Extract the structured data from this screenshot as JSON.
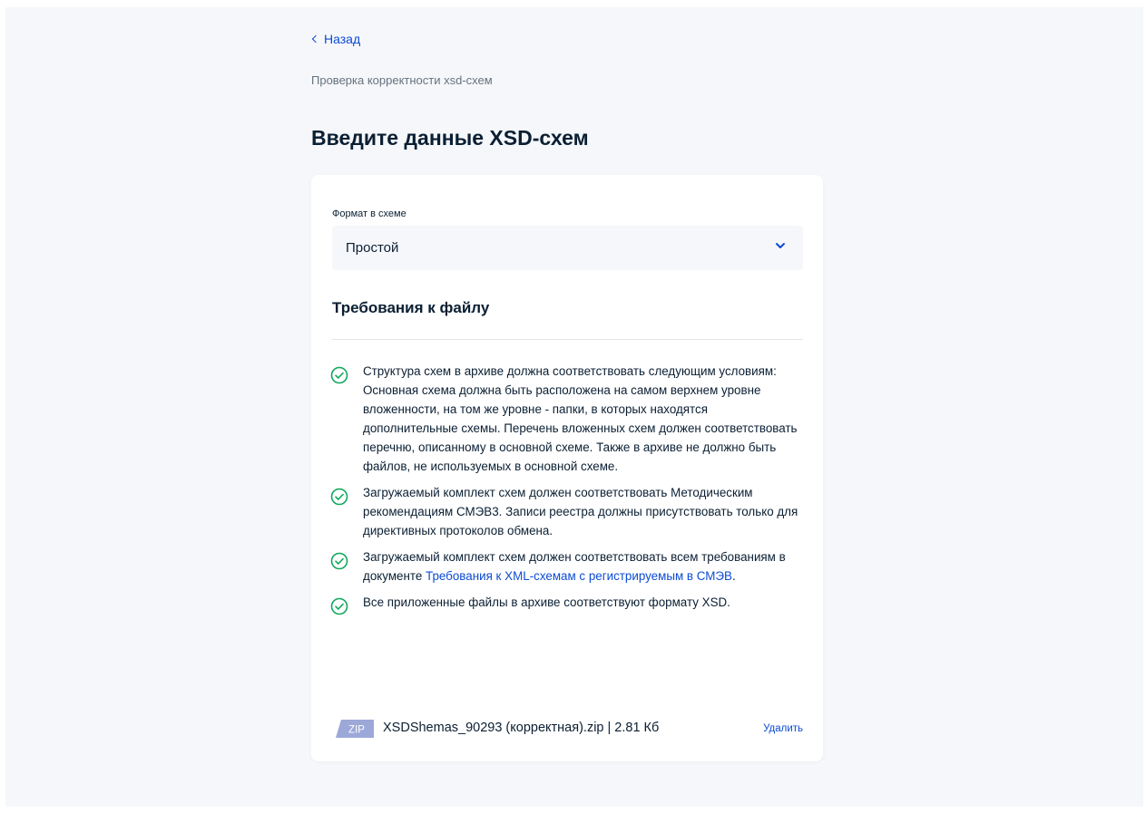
{
  "nav": {
    "back_label": "Назад",
    "breadcrumb": "Проверка корректности xsd-схем"
  },
  "page": {
    "title": "Введите данные XSD-схем"
  },
  "form": {
    "format_label": "Формат в схеме",
    "format_value": "Простой"
  },
  "requirements": {
    "title": "Требования к файлу",
    "items": [
      {
        "text": "Структура схем в архиве должна соответствовать следующим условиям: Основная схема должна быть расположена на самом верхнем уровне вложенности, на том же уровне - папки, в которых находятся дополнительные схемы. Перечень вложенных схем должен соответствовать перечню, описанному в основной схеме. Также в архиве не должно быть файлов, не используемых в основной схеме."
      },
      {
        "text": "Загружаемый комплект схем должен соответствовать Методическим рекомендациям СМЭВ3. Записи реестра должны присутствовать только для директивных протоколов обмена."
      },
      {
        "text_before": "Загружаемый комплект схем должен соответствовать всем требованиям в документе ",
        "link_text": "Требования к XML-схемам с регистрируемым в СМЭВ",
        "text_after": "."
      },
      {
        "text": "Все приложенные файлы в архиве соответствуют формату XSD."
      }
    ]
  },
  "file": {
    "badge": "ZIP",
    "name": "XSDShemas_90293 (корректная).zip | 2.81 Кб",
    "delete_label": "Удалить"
  },
  "colors": {
    "accent": "#0d4cd3",
    "success": "#11a75d",
    "text": "#0b1f33",
    "muted": "#66727f",
    "background": "#f5f7fa",
    "zip_badge": "#9ba8d8"
  },
  "icons": {
    "back": "chevron-left-icon",
    "select": "chevron-down-icon",
    "check": "check-circle-icon",
    "file": "zip-file-icon"
  }
}
